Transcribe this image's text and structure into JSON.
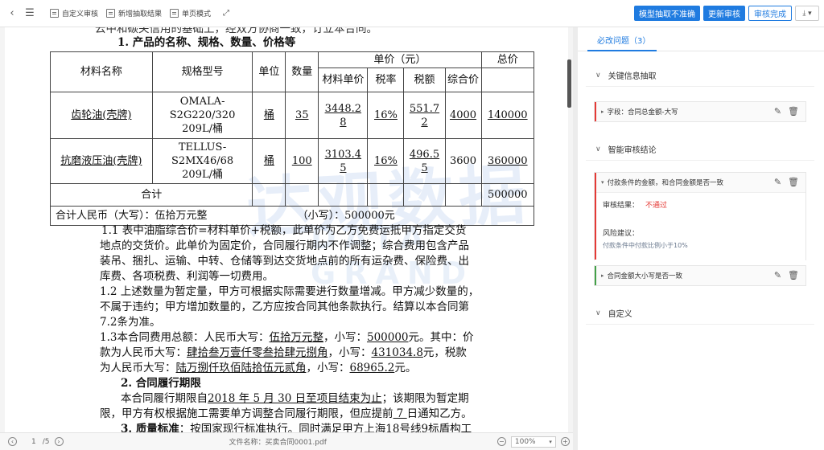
{
  "toolbar": {
    "custom_review": "自定义审核",
    "new_extract": "新增抽取结果",
    "single_page": "单页模式",
    "btn_model_inaccurate": "模型抽取不准确",
    "btn_update_review": "更新审核",
    "btn_review_done": "审核完成"
  },
  "doc": {
    "top_cut": "云中和碳关信用的基础上，经双方协商一致，订立本合同。",
    "heading1": "1. 产品的名称、规格、数量、价格等",
    "table": {
      "h_name": "材料名称",
      "h_model": "规格型号",
      "h_unit": "单位",
      "h_qty": "数量",
      "h_unit_price": "单价（元）",
      "h_total": "总价",
      "h_mat_price": "材料单价",
      "h_tax_rate": "税率",
      "h_tax": "税额",
      "h_comp": "综合价",
      "rows": [
        {
          "name": "齿轮油(壳牌)",
          "model": "OMALA-S2G220/320 209L/桶",
          "model1": "OMALA-",
          "model2": "S2G220/320",
          "model3": "209L/桶",
          "unit": "桶",
          "qty": "35",
          "mp1": "3448.2",
          "mp2": "8",
          "rate": "16%",
          "tax1": "551.7",
          "tax2": "2",
          "comp": "4000",
          "total": "140000"
        },
        {
          "name": "抗磨液压油(壳牌)",
          "model": "TELLUS-S2MX46/68 209L/桶",
          "model1": "TELLUS-",
          "model2": "S2MX46/68",
          "model3": "209L/桶",
          "unit": "桶",
          "qty": "100",
          "mp1": "3103.4",
          "mp2": "5",
          "rate": "16%",
          "tax1": "496.5",
          "tax2": "5",
          "comp": "3600",
          "total": "360000"
        }
      ],
      "sum_label": "合计",
      "sum_total": "500000",
      "rmb_label": "合计人民币（大写）：伍拾万元整",
      "rmb_small": "（小写）：500000元"
    },
    "p1_1a": "1.1 表中油脂综合价=材料单价+税额，此单价为乙方免费运抵甲方指定交货",
    "p1_1b": "地点的交货价。此单价为固定价，合同履行期内不作调整；综合费用包含产品",
    "p1_1c": "装吊、捆扎、运输、中转、仓储等到达交货地点前的所有运杂费、保险费、出",
    "p1_1d": "库费、各项税费、利润等一切费用。",
    "p1_2a": "1.2 上述数量为暂定量，甲方可根据实际需要进行数量增减。甲方减少数量的，",
    "p1_2b": "不属于违约；甲方增加数量的，乙方应按合同其他条款执行。结算以本合同第",
    "p1_2c": "7.2条为准。",
    "p1_3a_pre": "1.3本合同费用总额：人民币大写：",
    "p1_3a_u1": "伍拾万元整",
    "p1_3a_mid": "，小写：",
    "p1_3a_u2": "500000",
    "p1_3a_post": "元。其中：价",
    "p1_3b_pre": "款为人民币大写：",
    "p1_3b_u1": "肆拾叁万壹仟零叁拾肆元捌角",
    "p1_3b_mid": "，小写：",
    "p1_3b_u2": "431034.8",
    "p1_3b_post": "元，税款",
    "p1_3c_pre": "为人民币大写：",
    "p1_3c_u1": "陆万捌仟玖佰陆拾伍元贰角",
    "p1_3c_mid": "，小写：",
    "p1_3c_u2": "68965.2",
    "p1_3c_post": "元。",
    "heading2": "2. 合同履行期限",
    "p2a_pre": "本合同履行期限自",
    "p2a_u": "2018 年 5 月 30 日至项目结束为止",
    "p2a_post": "；该期限为暂定期",
    "p2b_pre": "限，甲方有权根据施工需要单方调整合同履行期限，但应提前",
    "p2b_u": " 7 ",
    "p2b_post": "日通知乙方。",
    "heading3": "3. 质量标准",
    "p3": "：按国家现行标准执行。同时满足甲方上海18号线9标盾构工",
    "watermark": "达观数据",
    "watermark2": "DATA GRAND"
  },
  "status": {
    "page_current": "1",
    "page_total": "/5",
    "filename": "文件名称：买卖合同0001.pdf",
    "zoom": "100%"
  },
  "panel": {
    "tab_label": "必改问题（3）",
    "sec1_title": "关键信息抽取",
    "card1_title": "字段：合同总金额-大写",
    "sec2_title": "智能审核结论",
    "card2_title": "付款条件的金额，和合同金额是否一致",
    "result_label": "审核结果：",
    "result_value": "不通过",
    "risk_label": "风险建议：",
    "risk_text": "付款条件中付款比例小于10%",
    "card3_title": "合同金额大小写是否一致",
    "sec3_title": "自定义"
  }
}
